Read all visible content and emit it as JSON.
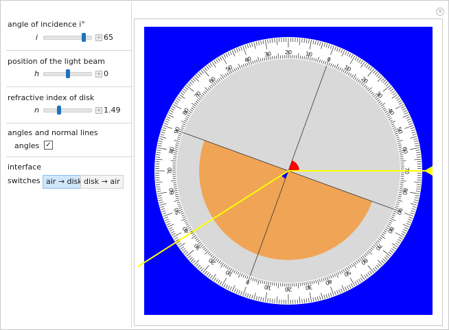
{
  "panel": {
    "incidence": {
      "title": "angle of incidence i°",
      "symbol": "i",
      "value": "65",
      "fraction": 0.87
    },
    "position": {
      "title": "position of the light beam",
      "symbol": "h",
      "value": "0",
      "fraction": 0.5
    },
    "index": {
      "title": "refractive index of disk",
      "symbol": "n",
      "value": "1.49",
      "fraction": 0.3
    },
    "display": {
      "title": "angles and normal lines",
      "checkbox_label": "angles",
      "checked": "✓"
    },
    "interface": {
      "title": "interface",
      "switches_label": "switches",
      "options": [
        "air → disk",
        "disk → air"
      ],
      "selected": "air → disk"
    }
  },
  "plot": {
    "background": "#0000ff",
    "disk_color": "#d9d9d9",
    "half_disk_color": "#f0a556",
    "beam_color": "#ffff00",
    "incidence_arc_color": "#ff0000",
    "refraction_arc_color": "#0000ff",
    "scale_outer_labels": [
      "0",
      "10",
      "20",
      "30",
      "40",
      "50",
      "60",
      "70",
      "80",
      "90",
      "80",
      "70",
      "60",
      "50",
      "40",
      "30",
      "20",
      "10",
      "0",
      "10",
      "20",
      "30",
      "40",
      "50",
      "60",
      "70",
      "80",
      "90",
      "80",
      "70",
      "60",
      "50",
      "40",
      "30",
      "20",
      "10"
    ],
    "scale_inner_labels": [
      "0",
      "10",
      "20",
      "30",
      "40",
      "50",
      "60",
      "70",
      "80",
      "90",
      "80",
      "70",
      "60",
      "50",
      "40",
      "30",
      "20",
      "10",
      "0",
      "10",
      "20",
      "30",
      "40",
      "50",
      "60",
      "70",
      "80",
      "90",
      "80",
      "70",
      "60",
      "50",
      "40",
      "30",
      "20",
      "10"
    ],
    "incidence_deg": 65,
    "refraction_deg": 37.5,
    "n": 1.49
  },
  "icons": {
    "close": "close-icon",
    "plus": "plus-icon",
    "check": "check-icon"
  }
}
